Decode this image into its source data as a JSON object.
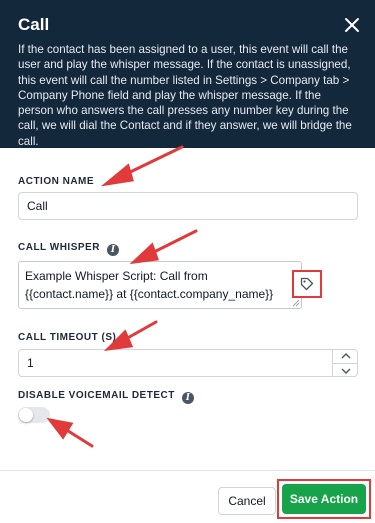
{
  "modal": {
    "title": "Call",
    "description": "If the contact has been assigned to a user, this event will call the user and play the whisper message. If the contact is unassigned, this event will call the number listed in Settings > Company tab > Company Phone field and play the whisper message. If the person who answers the call presses any number key during the call, we will dial the Contact and if they answer, we will bridge the call."
  },
  "fields": {
    "action_name": {
      "label": "ACTION NAME",
      "value": "Call"
    },
    "call_whisper": {
      "label": "CALL WHISPER",
      "value": "Example Whisper Script: Call from {{contact.name}} at {{contact.company_name}}"
    },
    "call_timeout": {
      "label": "CALL TIMEOUT (S)",
      "value": "1"
    },
    "disable_voicemail": {
      "label": "DISABLE VOICEMAIL DETECT",
      "enabled": false
    }
  },
  "footer": {
    "cancel_label": "Cancel",
    "save_label": "Save Action"
  },
  "colors": {
    "header_bg": "#14283c",
    "save_green": "#16a34a",
    "annotation_red": "#e03a3a"
  },
  "icons": [
    "close-icon",
    "info-icon",
    "tag-icon",
    "chevron-up-icon",
    "chevron-down-icon"
  ]
}
